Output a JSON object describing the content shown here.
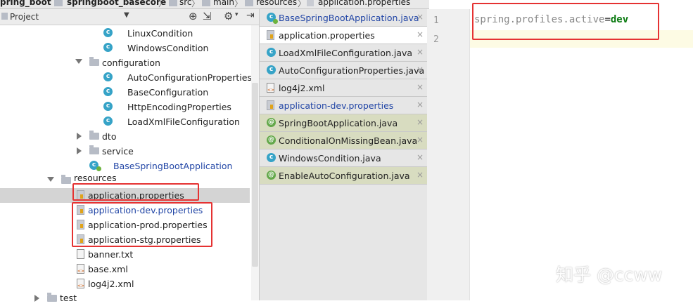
{
  "breadcrumb": {
    "items": [
      "pring_boot",
      "springboot_basecore",
      "src",
      "main",
      "resources",
      "application.properties"
    ],
    "separator": "〉"
  },
  "project_panel": {
    "title": "Project",
    "dropdown_icon": "chevron-down-icon",
    "toolbar_icons": [
      "target-icon",
      "divider-icon",
      "gear-icon",
      "hide-icon"
    ]
  },
  "tree": {
    "items": [
      {
        "label": "LinuxCondition",
        "icon": "class-icon"
      },
      {
        "label": "WindowsCondition",
        "icon": "class-icon"
      },
      {
        "label": "configuration",
        "icon": "package-icon",
        "expanded": true
      },
      {
        "label": "AutoConfigurationProperties",
        "icon": "class-icon"
      },
      {
        "label": "BaseConfiguration",
        "icon": "class-icon"
      },
      {
        "label": "HttpEncodingProperties",
        "icon": "class-icon"
      },
      {
        "label": "LoadXmlFileConfiguration",
        "icon": "class-icon"
      },
      {
        "label": "dto",
        "icon": "package-icon",
        "expanded": false
      },
      {
        "label": "service",
        "icon": "package-icon",
        "expanded": false
      },
      {
        "label": "BaseSpringBootApplication",
        "icon": "spring-boot-class-icon"
      },
      {
        "label": "resources",
        "icon": "folder-icon",
        "expanded": true
      },
      {
        "label": "application.properties",
        "icon": "properties-icon",
        "selected": true
      },
      {
        "label": "application-dev.properties",
        "icon": "properties-icon"
      },
      {
        "label": "application-prod.properties",
        "icon": "properties-icon"
      },
      {
        "label": "application-stg.properties",
        "icon": "properties-icon"
      },
      {
        "label": "banner.txt",
        "icon": "text-file-icon"
      },
      {
        "label": "base.xml",
        "icon": "xml-file-icon"
      },
      {
        "label": "log4j2.xml",
        "icon": "xml-file-icon"
      },
      {
        "label": "test",
        "icon": "folder-icon",
        "expanded": false
      }
    ]
  },
  "tabs": [
    {
      "label": "BaseSpringBootApplication.java",
      "icon": "class-icon"
    },
    {
      "label": "application.properties",
      "icon": "properties-icon",
      "active": true
    },
    {
      "label": "LoadXmlFileConfiguration.java",
      "icon": "class-icon"
    },
    {
      "label": "AutoConfigurationProperties.java",
      "icon": "class-icon"
    },
    {
      "label": "log4j2.xml",
      "icon": "xml-file-icon"
    },
    {
      "label": "application-dev.properties",
      "icon": "properties-icon"
    },
    {
      "label": "SpringBootApplication.java",
      "icon": "annotation-icon"
    },
    {
      "label": "ConditionalOnMissingBean.java",
      "icon": "annotation-icon"
    },
    {
      "label": "WindowsCondition.java",
      "icon": "class-icon"
    },
    {
      "label": "EnableAutoConfiguration.java",
      "icon": "annotation-icon"
    }
  ],
  "tab_close_glyph": "×",
  "editor": {
    "line_numbers": [
      "1",
      "2"
    ],
    "code_key": "spring.profiles.active",
    "code_eq": "=",
    "code_value": "dev"
  },
  "watermark": "知乎 @ccww",
  "colors": {
    "highlight_box": "#e53232",
    "value_green": "#0a7a10",
    "link_blue": "#2246a6",
    "class_icon": "#36a3c7"
  }
}
